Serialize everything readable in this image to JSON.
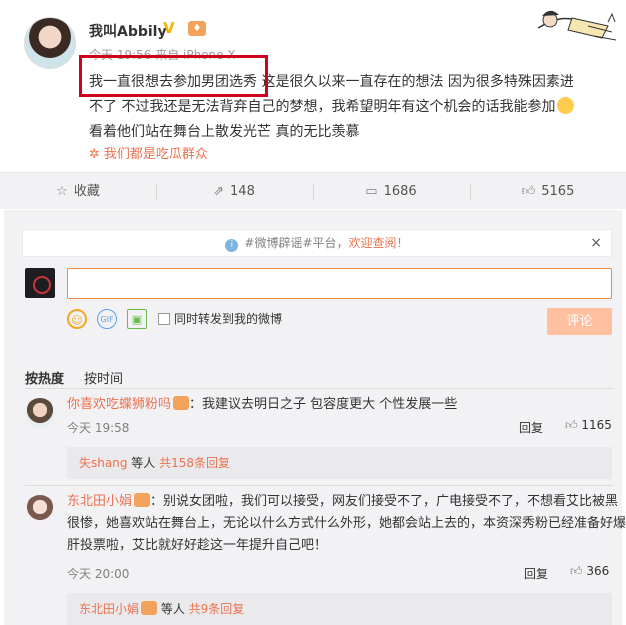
{
  "post": {
    "username": "我叫Abbily",
    "meta": "今天 19:56 来自 iPhone X",
    "line1": "我一直很想去参加男团选秀 这是很久以来一直存在的想法  因为很多特殊因素进",
    "line2": "不了  不过我还是无法背弃自己的梦想，我希望明年有这个机会的话我能参加",
    "line3": "看着他们站在舞台上散发光芒 真的无比羡慕",
    "topic": "我们都是吃瓜群众"
  },
  "actions": {
    "favorite": "收藏",
    "forward": "148",
    "comment": "1686",
    "like": "5165"
  },
  "notice": {
    "prefix": "#微博辟谣#平台，",
    "link": "欢迎查阅！",
    "close": "×"
  },
  "composer": {
    "gif": "GIF",
    "forward_label": "同时转发到我的微博",
    "submit": "评论"
  },
  "sort": {
    "hot": "按热度",
    "time": "按时间"
  },
  "comments": [
    {
      "user": "你喜欢吃蝶狮粉吗",
      "text": "：我建议去明日之子 包容度更大 个性发展一些",
      "time": "今天 19:58",
      "reply": "回复",
      "likes": "1165",
      "replies_user": "失shang",
      "replies_mid": " 等人 ",
      "replies_link": "共158条回复"
    },
    {
      "user": "东北田小娟",
      "text1": "：别说女团啦，我们可以接受，网友们接受不了，广电接受不了，不想看艾比被黑",
      "text2": "很惨，她喜欢站在舞台上，无论以什么方式什么外形，她都会站上去的，本资深秀粉已经准备好爆",
      "text3": "肝投票啦，艾比就好好趁这一年提升自己吧！",
      "time": "今天 20:00",
      "reply": "回复",
      "likes": "366",
      "replies_user": "东北田小娟",
      "replies_mid": " 等人 ",
      "replies_link": "共9条回复"
    }
  ],
  "colors": {
    "accent": "#eb7350",
    "highlight_box": "#d0021b",
    "panel_bg": "#f2f2f5"
  }
}
